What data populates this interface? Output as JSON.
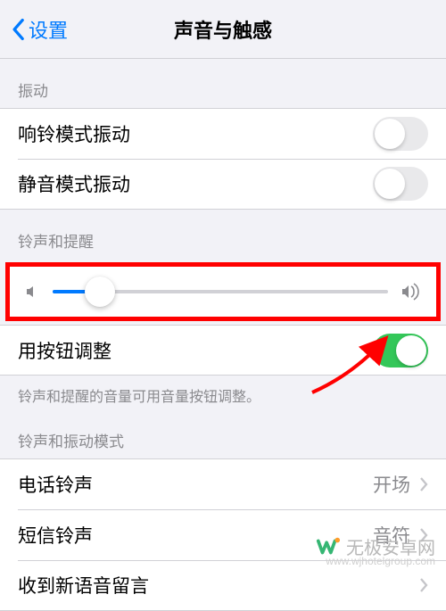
{
  "nav": {
    "back_label": "设置",
    "title": "声音与触感"
  },
  "vibration": {
    "header": "振动",
    "ring_label": "响铃模式振动",
    "ring_on": false,
    "silent_label": "静音模式振动",
    "silent_on": false
  },
  "ringer": {
    "header": "铃声和提醒",
    "slider_value": 0.14,
    "button_adjust_label": "用按钮调整",
    "button_adjust_on": true,
    "footnote": "铃声和提醒的音量可用音量按钮调整。"
  },
  "patterns": {
    "header": "铃声和振动模式",
    "items": [
      {
        "label": "电话铃声",
        "value": "开场"
      },
      {
        "label": "短信铃声",
        "value": "音符"
      },
      {
        "label": "收到新语音留言",
        "value": ""
      }
    ]
  },
  "watermark": {
    "text": "无极安卓网",
    "url": "www.wjhotelgroup.com"
  },
  "colors": {
    "accent": "#007aff",
    "switch_on": "#34c759",
    "highlight": "#ff0000"
  }
}
